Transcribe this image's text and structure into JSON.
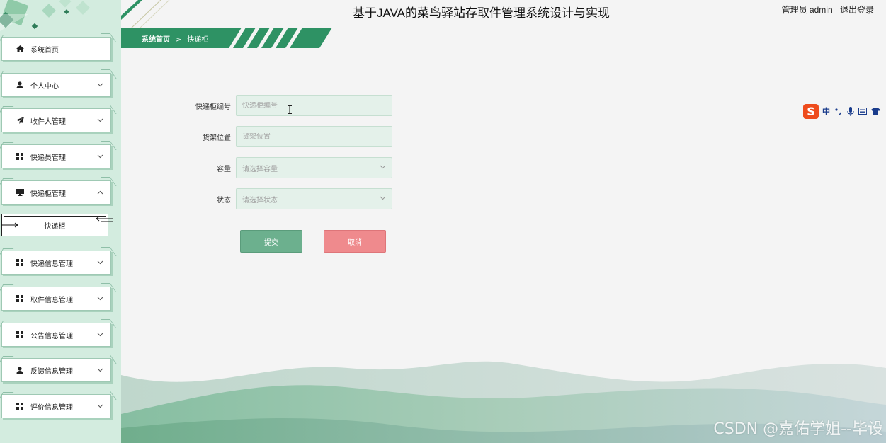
{
  "header": {
    "title": "基于JAVA的菜鸟驿站存取件管理系统设计与实现",
    "user": "管理员 admin",
    "logout_label": "退出登录"
  },
  "breadcrumb": {
    "home": "系统首页",
    "separator": ">",
    "current": "快递柜"
  },
  "sidebar": {
    "items": [
      {
        "label": "系统首页",
        "icon": "home-icon"
      },
      {
        "label": "个人中心",
        "icon": "person-icon",
        "expanded": false
      },
      {
        "label": "收件人管理",
        "icon": "paper-plane-icon",
        "expanded": false
      },
      {
        "label": "快递员管理",
        "icon": "grid-icon",
        "expanded": false
      },
      {
        "label": "快递柜管理",
        "icon": "monitor-icon",
        "expanded": true
      },
      {
        "label": "快递信息管理",
        "icon": "grid-icon",
        "expanded": false
      },
      {
        "label": "取件信息管理",
        "icon": "grid-icon",
        "expanded": false
      },
      {
        "label": "公告信息管理",
        "icon": "grid-icon",
        "expanded": false
      },
      {
        "label": "反馈信息管理",
        "icon": "person-icon",
        "expanded": false
      },
      {
        "label": "评价信息管理",
        "icon": "grid-icon",
        "expanded": false
      }
    ],
    "sub_item": {
      "label": "快递柜"
    }
  },
  "form": {
    "cabinet_no": {
      "label": "快递柜编号",
      "placeholder": "快递柜编号",
      "value": ""
    },
    "shelf_location": {
      "label": "货架位置",
      "placeholder": "货架位置",
      "value": ""
    },
    "capacity": {
      "label": "容量",
      "placeholder": "请选择容量"
    },
    "status": {
      "label": "状态",
      "placeholder": "请选择状态"
    },
    "submit_label": "提交",
    "cancel_label": "取消"
  },
  "ime": {
    "text": "中",
    "logo": "S"
  },
  "watermark": "CSDN @嘉佑学姐--毕设",
  "colors": {
    "primary_green": "#2e9264",
    "sidebar_bg": "#d3ecdf",
    "submit": "#6cb08e",
    "cancel": "#ef8a8d"
  }
}
